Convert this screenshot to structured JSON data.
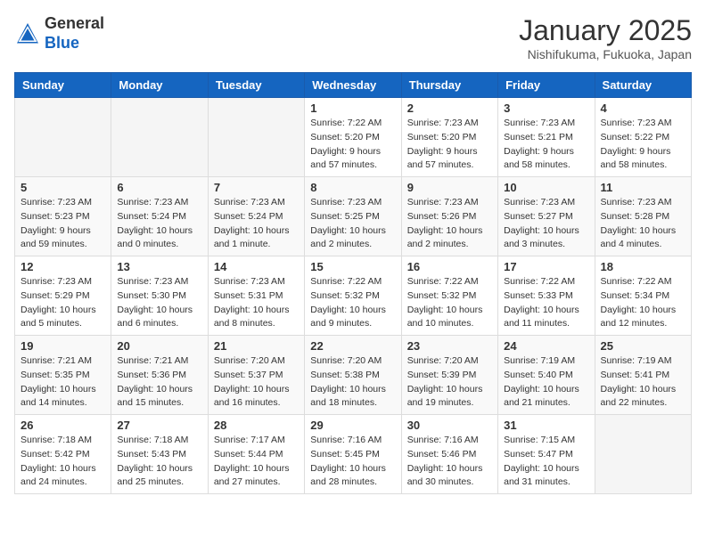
{
  "header": {
    "logo_general": "General",
    "logo_blue": "Blue",
    "month_title": "January 2025",
    "location": "Nishifukuma, Fukuoka, Japan"
  },
  "days_of_week": [
    "Sunday",
    "Monday",
    "Tuesday",
    "Wednesday",
    "Thursday",
    "Friday",
    "Saturday"
  ],
  "weeks": [
    [
      {
        "day": "",
        "info": ""
      },
      {
        "day": "",
        "info": ""
      },
      {
        "day": "",
        "info": ""
      },
      {
        "day": "1",
        "info": "Sunrise: 7:22 AM\nSunset: 5:20 PM\nDaylight: 9 hours\nand 57 minutes."
      },
      {
        "day": "2",
        "info": "Sunrise: 7:23 AM\nSunset: 5:20 PM\nDaylight: 9 hours\nand 57 minutes."
      },
      {
        "day": "3",
        "info": "Sunrise: 7:23 AM\nSunset: 5:21 PM\nDaylight: 9 hours\nand 58 minutes."
      },
      {
        "day": "4",
        "info": "Sunrise: 7:23 AM\nSunset: 5:22 PM\nDaylight: 9 hours\nand 58 minutes."
      }
    ],
    [
      {
        "day": "5",
        "info": "Sunrise: 7:23 AM\nSunset: 5:23 PM\nDaylight: 9 hours\nand 59 minutes."
      },
      {
        "day": "6",
        "info": "Sunrise: 7:23 AM\nSunset: 5:24 PM\nDaylight: 10 hours\nand 0 minutes."
      },
      {
        "day": "7",
        "info": "Sunrise: 7:23 AM\nSunset: 5:24 PM\nDaylight: 10 hours\nand 1 minute."
      },
      {
        "day": "8",
        "info": "Sunrise: 7:23 AM\nSunset: 5:25 PM\nDaylight: 10 hours\nand 2 minutes."
      },
      {
        "day": "9",
        "info": "Sunrise: 7:23 AM\nSunset: 5:26 PM\nDaylight: 10 hours\nand 2 minutes."
      },
      {
        "day": "10",
        "info": "Sunrise: 7:23 AM\nSunset: 5:27 PM\nDaylight: 10 hours\nand 3 minutes."
      },
      {
        "day": "11",
        "info": "Sunrise: 7:23 AM\nSunset: 5:28 PM\nDaylight: 10 hours\nand 4 minutes."
      }
    ],
    [
      {
        "day": "12",
        "info": "Sunrise: 7:23 AM\nSunset: 5:29 PM\nDaylight: 10 hours\nand 5 minutes."
      },
      {
        "day": "13",
        "info": "Sunrise: 7:23 AM\nSunset: 5:30 PM\nDaylight: 10 hours\nand 6 minutes."
      },
      {
        "day": "14",
        "info": "Sunrise: 7:23 AM\nSunset: 5:31 PM\nDaylight: 10 hours\nand 8 minutes."
      },
      {
        "day": "15",
        "info": "Sunrise: 7:22 AM\nSunset: 5:32 PM\nDaylight: 10 hours\nand 9 minutes."
      },
      {
        "day": "16",
        "info": "Sunrise: 7:22 AM\nSunset: 5:32 PM\nDaylight: 10 hours\nand 10 minutes."
      },
      {
        "day": "17",
        "info": "Sunrise: 7:22 AM\nSunset: 5:33 PM\nDaylight: 10 hours\nand 11 minutes."
      },
      {
        "day": "18",
        "info": "Sunrise: 7:22 AM\nSunset: 5:34 PM\nDaylight: 10 hours\nand 12 minutes."
      }
    ],
    [
      {
        "day": "19",
        "info": "Sunrise: 7:21 AM\nSunset: 5:35 PM\nDaylight: 10 hours\nand 14 minutes."
      },
      {
        "day": "20",
        "info": "Sunrise: 7:21 AM\nSunset: 5:36 PM\nDaylight: 10 hours\nand 15 minutes."
      },
      {
        "day": "21",
        "info": "Sunrise: 7:20 AM\nSunset: 5:37 PM\nDaylight: 10 hours\nand 16 minutes."
      },
      {
        "day": "22",
        "info": "Sunrise: 7:20 AM\nSunset: 5:38 PM\nDaylight: 10 hours\nand 18 minutes."
      },
      {
        "day": "23",
        "info": "Sunrise: 7:20 AM\nSunset: 5:39 PM\nDaylight: 10 hours\nand 19 minutes."
      },
      {
        "day": "24",
        "info": "Sunrise: 7:19 AM\nSunset: 5:40 PM\nDaylight: 10 hours\nand 21 minutes."
      },
      {
        "day": "25",
        "info": "Sunrise: 7:19 AM\nSunset: 5:41 PM\nDaylight: 10 hours\nand 22 minutes."
      }
    ],
    [
      {
        "day": "26",
        "info": "Sunrise: 7:18 AM\nSunset: 5:42 PM\nDaylight: 10 hours\nand 24 minutes."
      },
      {
        "day": "27",
        "info": "Sunrise: 7:18 AM\nSunset: 5:43 PM\nDaylight: 10 hours\nand 25 minutes."
      },
      {
        "day": "28",
        "info": "Sunrise: 7:17 AM\nSunset: 5:44 PM\nDaylight: 10 hours\nand 27 minutes."
      },
      {
        "day": "29",
        "info": "Sunrise: 7:16 AM\nSunset: 5:45 PM\nDaylight: 10 hours\nand 28 minutes."
      },
      {
        "day": "30",
        "info": "Sunrise: 7:16 AM\nSunset: 5:46 PM\nDaylight: 10 hours\nand 30 minutes."
      },
      {
        "day": "31",
        "info": "Sunrise: 7:15 AM\nSunset: 5:47 PM\nDaylight: 10 hours\nand 31 minutes."
      },
      {
        "day": "",
        "info": ""
      }
    ]
  ]
}
